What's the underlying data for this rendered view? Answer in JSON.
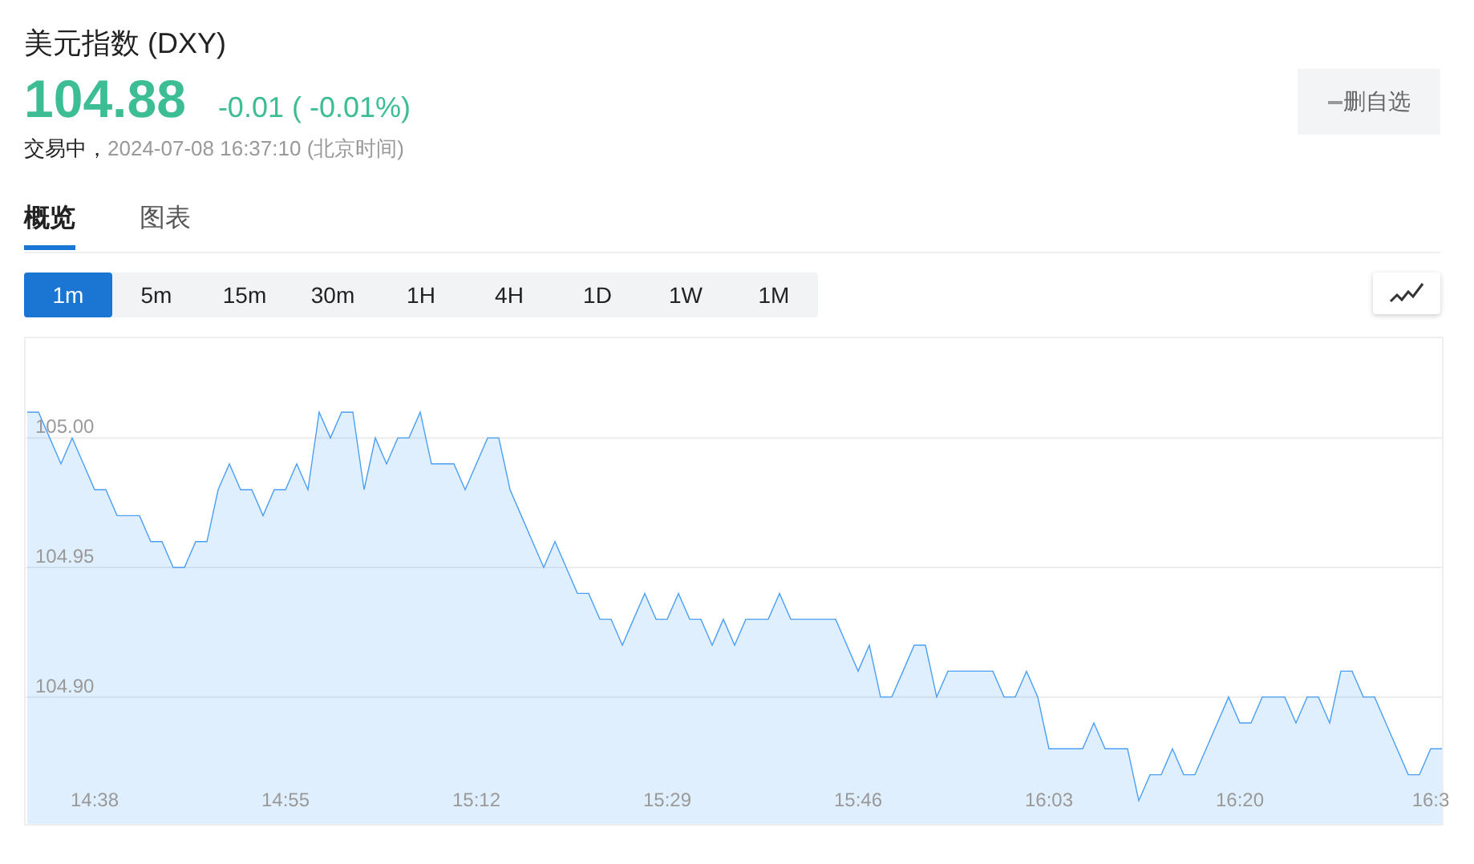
{
  "header": {
    "title": "美元指数 (DXY)",
    "price": "104.88",
    "change": "-0.01",
    "change_percent": "( -0.01%)",
    "status": "交易中，",
    "timestamp": "2024-07-08 16:37:10",
    "timezone": "(北京时间)"
  },
  "watchlist_button": {
    "label": "删自选"
  },
  "tabs": [
    {
      "label": "概览",
      "selected": true
    },
    {
      "label": "图表",
      "selected": false
    }
  ],
  "intervals": [
    {
      "label": "1m",
      "selected": true
    },
    {
      "label": "5m",
      "selected": false
    },
    {
      "label": "15m",
      "selected": false
    },
    {
      "label": "30m",
      "selected": false
    },
    {
      "label": "1H",
      "selected": false
    },
    {
      "label": "4H",
      "selected": false
    },
    {
      "label": "1D",
      "selected": false
    },
    {
      "label": "1W",
      "selected": false
    },
    {
      "label": "1M",
      "selected": false
    }
  ],
  "chart": {
    "chart_data": {
      "type": "area",
      "grid": true,
      "categories": [
        null,
        null,
        null,
        null,
        null,
        null,
        "14:38",
        null,
        null,
        null,
        null,
        null,
        null,
        null,
        null,
        null,
        null,
        null,
        null,
        null,
        null,
        null,
        null,
        "14:55",
        null,
        null,
        null,
        null,
        null,
        null,
        null,
        null,
        null,
        null,
        null,
        null,
        null,
        null,
        null,
        null,
        "15:12",
        null,
        null,
        null,
        null,
        null,
        null,
        null,
        null,
        null,
        null,
        null,
        null,
        null,
        null,
        null,
        null,
        "15:29",
        null,
        null,
        null,
        null,
        null,
        null,
        null,
        null,
        null,
        null,
        null,
        null,
        null,
        null,
        null,
        null,
        "15:46",
        null,
        null,
        null,
        null,
        null,
        null,
        null,
        null,
        null,
        null,
        null,
        null,
        null,
        null,
        null,
        null,
        "16:03",
        null,
        null,
        null,
        null,
        null,
        null,
        null,
        null,
        null,
        null,
        null,
        null,
        null,
        null,
        null,
        null,
        "16:20",
        null,
        null,
        null,
        null,
        null,
        null,
        null,
        null,
        null,
        null,
        null,
        null,
        null,
        null,
        null,
        null,
        "16:3",
        null
      ],
      "series": [
        {
          "color": "#4a9ff5",
          "values": [
            105.01,
            105.01,
            105.0,
            104.99,
            105.0,
            104.99,
            104.98,
            104.98,
            104.97,
            104.97,
            104.97,
            104.96,
            104.96,
            104.95,
            104.95,
            104.96,
            104.96,
            104.98,
            104.99,
            104.98,
            104.98,
            104.97,
            104.98,
            104.98,
            104.99,
            104.98,
            105.01,
            105.0,
            105.01,
            105.01,
            104.98,
            105.0,
            104.99,
            105.0,
            105.0,
            105.01,
            104.99,
            104.99,
            104.99,
            104.98,
            104.99,
            105.0,
            105.0,
            104.98,
            104.97,
            104.96,
            104.95,
            104.96,
            104.95,
            104.94,
            104.94,
            104.93,
            104.93,
            104.92,
            104.93,
            104.94,
            104.93,
            104.93,
            104.94,
            104.93,
            104.93,
            104.92,
            104.93,
            104.92,
            104.93,
            104.93,
            104.93,
            104.94,
            104.93,
            104.93,
            104.93,
            104.93,
            104.93,
            104.92,
            104.91,
            104.92,
            104.9,
            104.9,
            104.91,
            104.92,
            104.92,
            104.9,
            104.91,
            104.91,
            104.91,
            104.91,
            104.91,
            104.9,
            104.9,
            104.91,
            104.9,
            104.88,
            104.88,
            104.88,
            104.88,
            104.89,
            104.88,
            104.88,
            104.88,
            104.86,
            104.87,
            104.87,
            104.88,
            104.87,
            104.87,
            104.88,
            104.89,
            104.9,
            104.89,
            104.89,
            104.9,
            104.9,
            104.9,
            104.89,
            104.9,
            104.9,
            104.89,
            104.91,
            104.91,
            104.9,
            104.9,
            104.89,
            104.88,
            104.87,
            104.87,
            104.88,
            104.88
          ]
        }
      ],
      "ylim": [
        104.851,
        105.0385
      ],
      "yticks": [
        {
          "value": 104.9,
          "label": "104.90"
        },
        {
          "value": 104.95,
          "label": "104.95"
        },
        {
          "value": 105.0,
          "label": "105.00"
        }
      ]
    }
  }
}
